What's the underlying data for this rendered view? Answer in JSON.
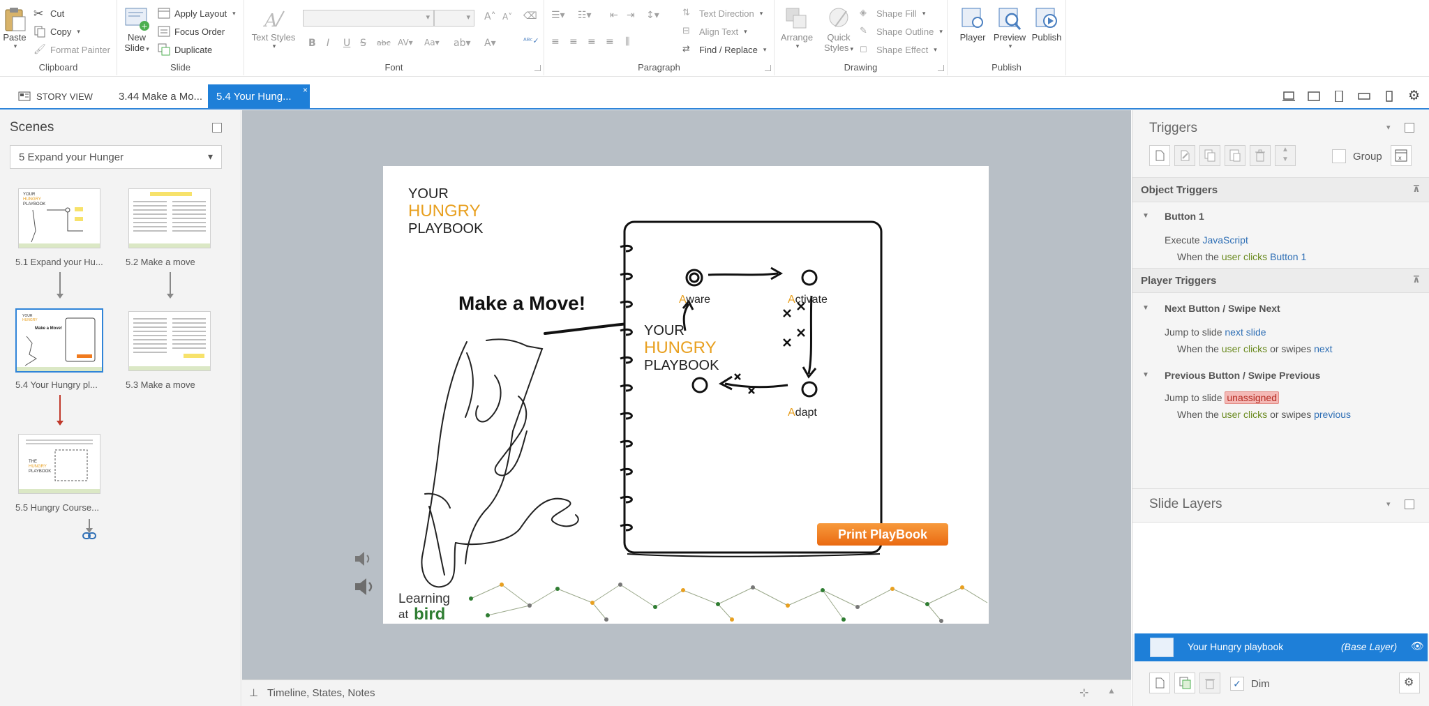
{
  "ribbon": {
    "clipboard": {
      "paste": "Paste",
      "cut": "Cut",
      "copy": "Copy",
      "format_painter": "Format Painter",
      "label": "Clipboard"
    },
    "slide": {
      "new_slide_line1": "New",
      "new_slide_line2": "Slide",
      "apply_layout": "Apply Layout",
      "focus_order": "Focus Order",
      "duplicate": "Duplicate",
      "label": "Slide"
    },
    "font": {
      "text_styles": "Text Styles",
      "label": "Font"
    },
    "paragraph": {
      "text_direction": "Text Direction",
      "align_text": "Align Text",
      "find_replace": "Find / Replace",
      "label": "Paragraph"
    },
    "drawing": {
      "arrange": "Arrange",
      "quick_styles_line1": "Quick",
      "quick_styles_line2": "Styles",
      "shape_fill": "Shape Fill",
      "shape_outline": "Shape Outline",
      "shape_effect": "Shape Effect",
      "label": "Drawing"
    },
    "publish": {
      "player": "Player",
      "preview": "Preview",
      "publish": "Publish",
      "label": "Publish"
    }
  },
  "tabs": {
    "story_view": "STORY VIEW",
    "tab1": "3.44 Make a Mo...",
    "tab2": "5.4 Your Hung..."
  },
  "scenes": {
    "title": "Scenes",
    "selected_scene": "5 Expand your Hunger",
    "thumbs": [
      {
        "label": "5.1 Expand your Hu..."
      },
      {
        "label": "5.2 Make a move"
      },
      {
        "label": "5.4 Your Hungry pl..."
      },
      {
        "label": "5.3 Make a move"
      },
      {
        "label": "5.5 Hungry Course..."
      }
    ]
  },
  "slide": {
    "logo_line1": "YOUR",
    "logo_line2": "HUNGRY",
    "logo_line3": "PLAYBOOK",
    "make_move": "Make a Move!",
    "nb_line1": "YOUR",
    "nb_line2": "HUNGRY",
    "nb_line3": "PLAYBOOK",
    "aware_first": "A",
    "aware_rest": "ware",
    "activate_first": "A",
    "activate_rest": "ctivate",
    "adapt_first": "A",
    "adapt_rest": "dapt",
    "print_btn": "Print PlayBook",
    "footer_line1": "Learning",
    "footer_at": "at",
    "footer_bird": "bird"
  },
  "status": {
    "timeline": "Timeline, States, Notes"
  },
  "triggers": {
    "title": "Triggers",
    "group": "Group",
    "object_triggers": "Object Triggers",
    "button1": "Button 1",
    "execute": "Execute",
    "javascript": "JavaScript",
    "when_the": "When the",
    "user_clicks": "user clicks",
    "button1_ref": "Button 1",
    "player_triggers": "Player Triggers",
    "next_head": "Next Button / Swipe Next",
    "jump_to_slide": "Jump to slide",
    "next_slide": "next slide",
    "or_swipes": "or swipes",
    "next": "next",
    "prev_head": "Previous Button / Swipe Previous",
    "unassigned": "unassigned",
    "previous": "previous"
  },
  "layers": {
    "title": "Slide Layers",
    "base_name": "Your Hungry playbook",
    "base_tag": "(Base Layer)",
    "dim": "Dim"
  },
  "colors": {
    "accent_blue": "#1e7fd8",
    "hungry_orange": "#e8a020",
    "print_btn": "#f07a1e",
    "bird_green": "#2f7d32"
  }
}
